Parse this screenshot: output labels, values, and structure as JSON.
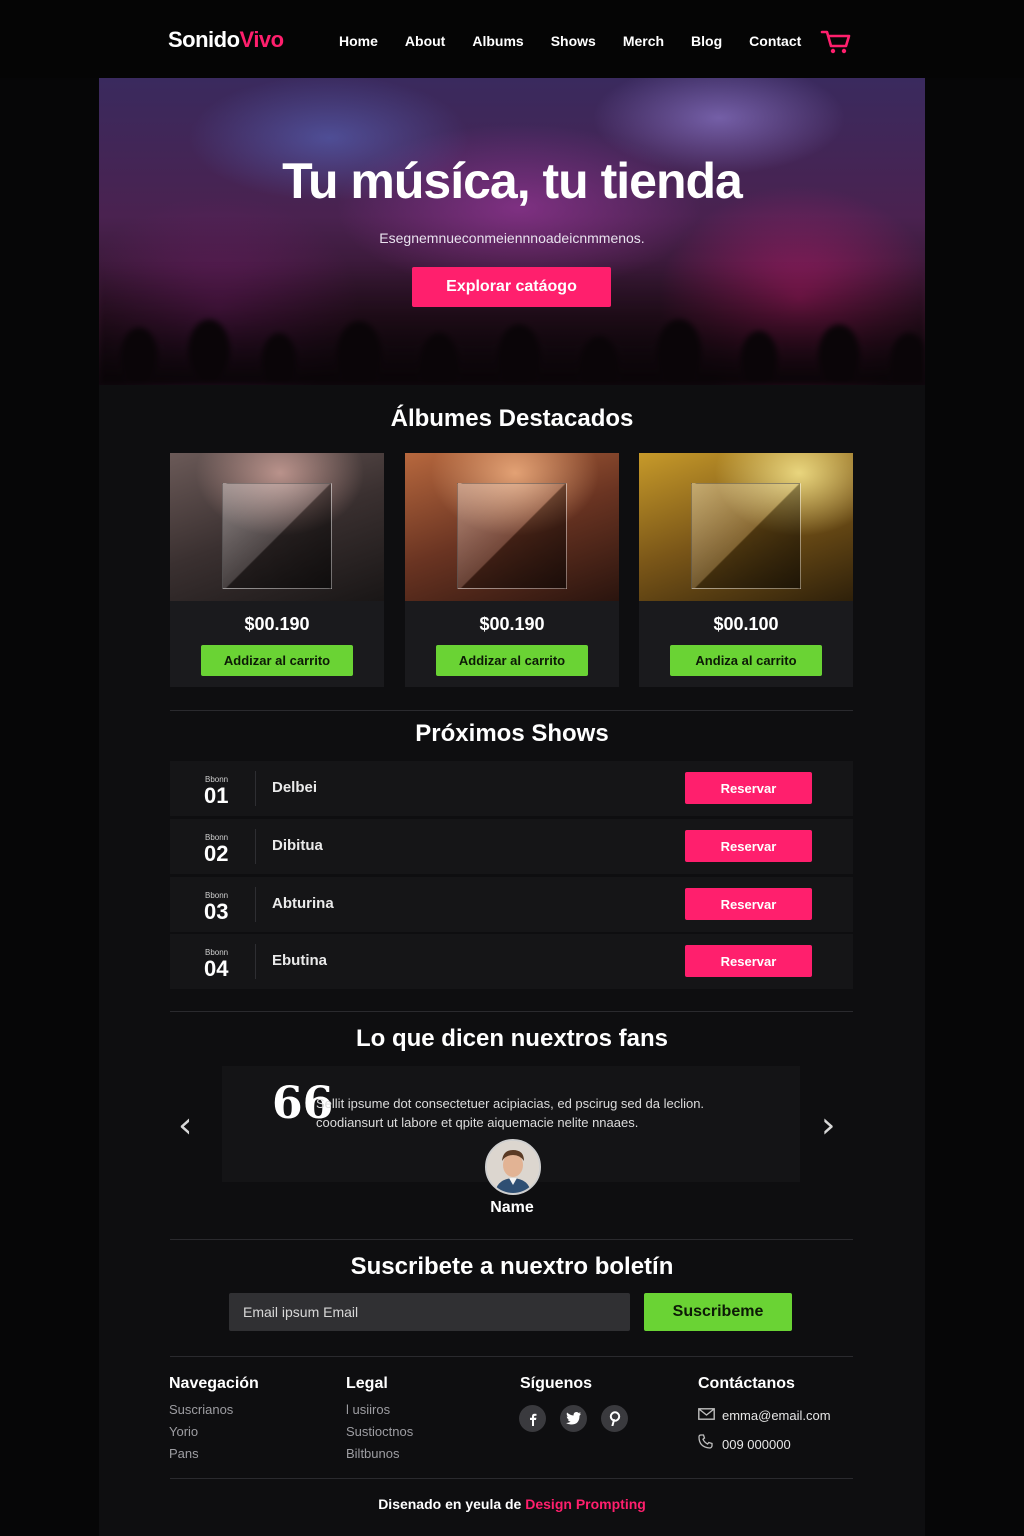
{
  "nav": {
    "logo_part1": "Sonido",
    "logo_part2": "Vivo",
    "items": [
      "Home",
      "About",
      "Albums",
      "Shows",
      "Merch",
      "Blog",
      "Contact"
    ],
    "cart_icon": "cart-icon"
  },
  "hero": {
    "title": "Tu músíca, tu tienda",
    "subtitle": "Esegnemnueconmeiennnoadeicnmmenos.",
    "button": "Explorar catáogo"
  },
  "albums": {
    "title": "Álbumes Destacados",
    "items": [
      {
        "price": "$00.190",
        "button": "Addizar al carrito"
      },
      {
        "price": "$00.190",
        "button": "Addizar al carrito"
      },
      {
        "price": "$00.100",
        "button": "Andiza al carrito"
      }
    ]
  },
  "shows": {
    "title": "Próximos Shows",
    "items": [
      {
        "small": "Bbonn",
        "number": "01",
        "name": "Delbei",
        "button": "Reservar"
      },
      {
        "small": "Bbonn",
        "number": "02",
        "name": "Dibitua",
        "button": "Reservar"
      },
      {
        "small": "Bbonn",
        "number": "03",
        "name": "Abturina",
        "button": "Reservar"
      },
      {
        "small": "Bbonn",
        "number": "04",
        "name": "Ebutina",
        "button": "Reservar"
      }
    ]
  },
  "testimonials": {
    "title": "Lo que dicen nuextros fans",
    "quote_mark": "66",
    "text": "Sellit ipsume dot consectetuer acipiacias, ed pscirug sed da leclion. coodiansurt ut labore et qpite aiquemacie nelite nnaaes.",
    "name": "Name",
    "prev_icon": "chevron-left-icon",
    "next_icon": "chevron-right-icon"
  },
  "newsletter": {
    "title": "Suscribete a nuextro boletín",
    "placeholder": "Email ipsum Email",
    "button": "Suscribeme"
  },
  "footer": {
    "nav_title": "Navegación",
    "nav_links": [
      "Suscrianos",
      "Yorio",
      "Pans"
    ],
    "legal_title": "Legal",
    "legal_links": [
      "l usiiros",
      "Sustioctnos",
      "Biltbunos"
    ],
    "social_title": "Síguenos",
    "social_icons": [
      "facebook-icon",
      "twitter-icon",
      "pinterest-icon"
    ],
    "contact_title": "Contáctanos",
    "email": "emma@email.com",
    "phone": "009 000000",
    "credit_prefix": "Disenado en yeula de",
    "credit_highlight": "Design Prompting"
  },
  "colors": {
    "accent": "#ff1f6d",
    "green": "#6ad334",
    "background": "#060607"
  }
}
